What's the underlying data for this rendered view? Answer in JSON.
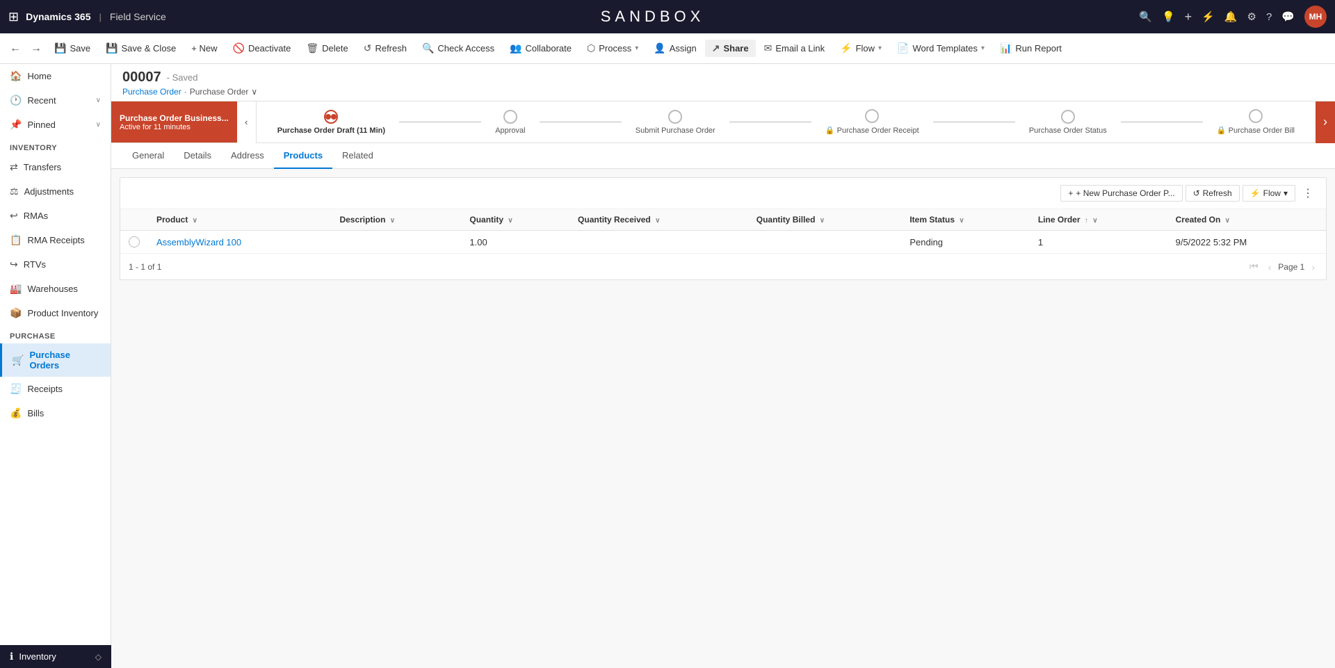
{
  "app": {
    "grid_icon": "⊞",
    "brand": "Dynamics 365",
    "separator": "|",
    "module": "Field Service",
    "sandbox_title": "SANDBOX"
  },
  "top_nav_icons": [
    {
      "name": "search-icon",
      "icon": "🔍"
    },
    {
      "name": "lightbulb-icon",
      "icon": "💡"
    },
    {
      "name": "plus-icon",
      "icon": "+"
    },
    {
      "name": "filter-icon",
      "icon": "⚡"
    },
    {
      "name": "bell-icon",
      "icon": "🔔"
    },
    {
      "name": "settings-icon",
      "icon": "⚙"
    },
    {
      "name": "help-icon",
      "icon": "?"
    },
    {
      "name": "chat-icon",
      "icon": "💬"
    }
  ],
  "avatar": {
    "initials": "MH",
    "bg_color": "#c8442a"
  },
  "command_bar": {
    "back_label": "←",
    "forward_label": "→",
    "save_label": "Save",
    "save_close_label": "Save & Close",
    "new_label": "+ New",
    "deactivate_label": "Deactivate",
    "delete_label": "Delete",
    "refresh_label": "Refresh",
    "check_access_label": "Check Access",
    "collaborate_label": "Collaborate",
    "process_label": "Process",
    "assign_label": "Assign",
    "share_label": "Share",
    "email_link_label": "Email a Link",
    "flow_label": "Flow",
    "word_templates_label": "Word Templates",
    "run_report_label": "Run Report"
  },
  "record": {
    "id": "00007",
    "status": "- Saved",
    "breadcrumb_parent": "Purchase Order",
    "breadcrumb_sep": "·",
    "breadcrumb_current": "Purchase Order",
    "breadcrumb_arrow": "∨"
  },
  "process": {
    "active_stage_title": "Purchase Order Business...",
    "active_stage_sub": "Active for 11 minutes",
    "stages": [
      {
        "label": "Purchase Order Draft  (11 Min)",
        "active": true,
        "locked": false
      },
      {
        "label": "Approval",
        "active": false,
        "locked": false
      },
      {
        "label": "Submit Purchase Order",
        "active": false,
        "locked": false
      },
      {
        "label": "Purchase Order Receipt",
        "active": false,
        "locked": true
      },
      {
        "label": "Purchase Order Status",
        "active": false,
        "locked": false
      },
      {
        "label": "Purchase Order Bill",
        "active": false,
        "locked": true
      }
    ]
  },
  "tabs": [
    {
      "label": "General",
      "active": false
    },
    {
      "label": "Details",
      "active": false
    },
    {
      "label": "Address",
      "active": false
    },
    {
      "label": "Products",
      "active": true
    },
    {
      "label": "Related",
      "active": false
    }
  ],
  "products_toolbar": {
    "new_btn": "+ New Purchase Order P...",
    "refresh_btn": "Refresh",
    "flow_btn": "Flow",
    "more_icon": "⋮"
  },
  "table": {
    "columns": [
      {
        "label": "Product",
        "sortable": true
      },
      {
        "label": "Description",
        "sortable": true
      },
      {
        "label": "Quantity",
        "sortable": true
      },
      {
        "label": "Quantity Received",
        "sortable": true
      },
      {
        "label": "Quantity Billed",
        "sortable": true
      },
      {
        "label": "Item Status",
        "sortable": true
      },
      {
        "label": "Line Order",
        "sortable": true,
        "sort_dir": "↑"
      },
      {
        "label": "Created On",
        "sortable": true
      }
    ],
    "rows": [
      {
        "product": "AssemblyWizard 100",
        "description": "",
        "quantity": "1.00",
        "quantity_received": "",
        "quantity_billed": "",
        "item_status": "Pending",
        "line_order": "1",
        "created_on": "9/5/2022 5:32 PM"
      }
    ]
  },
  "pagination": {
    "summary": "1 - 1 of 1",
    "page_label": "Page 1"
  },
  "sidebar": {
    "sections": [
      {
        "label": "Inventory",
        "items": [
          {
            "label": "Transfers",
            "icon": "↔",
            "active": false
          },
          {
            "label": "Adjustments",
            "icon": "⚖",
            "active": false
          },
          {
            "label": "RMAs",
            "icon": "↩",
            "active": false
          },
          {
            "label": "RMA Receipts",
            "icon": "📄",
            "active": false
          },
          {
            "label": "RTVs",
            "icon": "↪",
            "active": false
          },
          {
            "label": "Warehouses",
            "icon": "🏭",
            "active": false
          },
          {
            "label": "Product Inventory",
            "icon": "📦",
            "active": false
          }
        ]
      },
      {
        "label": "Purchase",
        "items": [
          {
            "label": "Purchase Orders",
            "icon": "🛒",
            "active": true
          },
          {
            "label": "Receipts",
            "icon": "🧾",
            "active": false
          },
          {
            "label": "Bills",
            "icon": "💰",
            "active": false
          }
        ]
      }
    ],
    "home_label": "Home",
    "recent_label": "Recent",
    "pinned_label": "Pinned",
    "bottom_label": "Inventory"
  }
}
